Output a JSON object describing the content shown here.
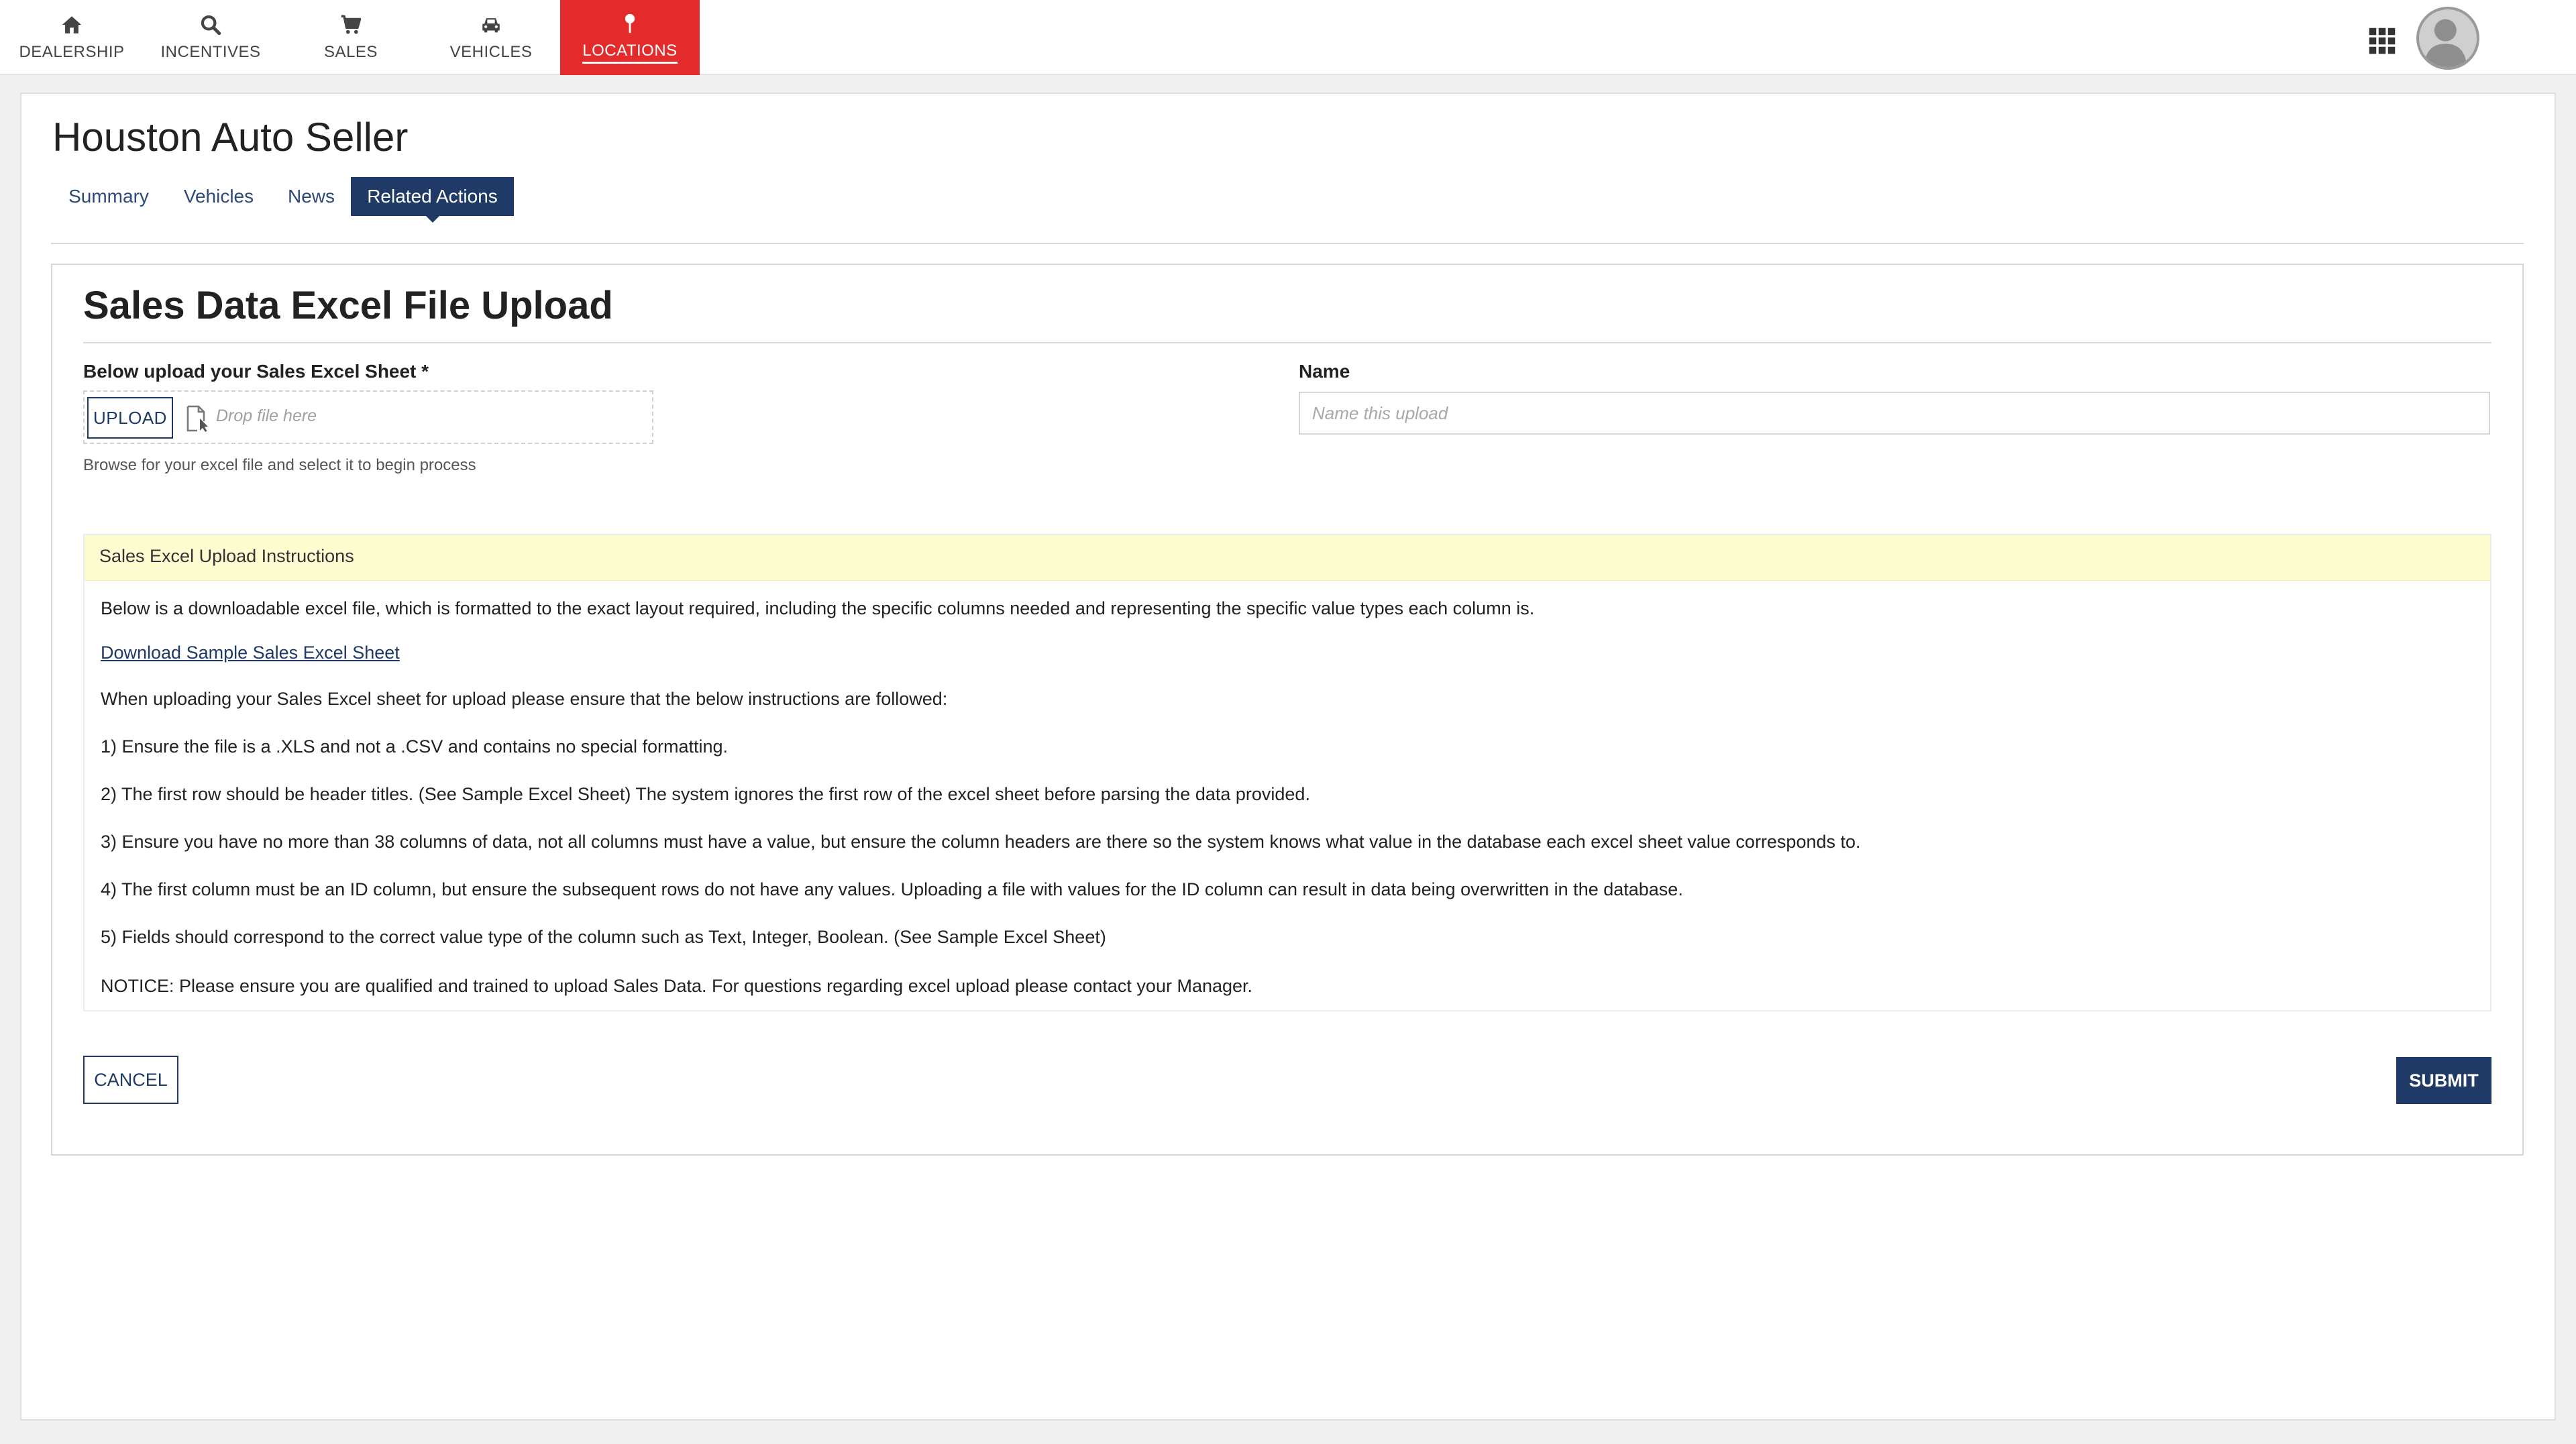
{
  "nav": {
    "items": [
      {
        "label": "DEALERSHIP",
        "icon": "home-icon"
      },
      {
        "label": "INCENTIVES",
        "icon": "search-icon"
      },
      {
        "label": "SALES",
        "icon": "cart-icon"
      },
      {
        "label": "VEHICLES",
        "icon": "car-icon"
      },
      {
        "label": "LOCATIONS",
        "icon": "pin-icon",
        "active": true
      }
    ],
    "accent_color": "#e32b2b",
    "apps_icon": "grid-icon",
    "avatar_icon": "user-avatar-icon"
  },
  "page": {
    "title": "Houston Auto Seller",
    "tabs": [
      {
        "label": "Summary"
      },
      {
        "label": "Vehicles"
      },
      {
        "label": "News"
      },
      {
        "label": "Related Actions",
        "active": true
      }
    ],
    "primary_color": "#1f3a66"
  },
  "form": {
    "title": "Sales Data Excel File Upload",
    "upload_label": "Below upload your Sales Excel Sheet *",
    "upload_button": "UPLOAD",
    "drop_placeholder": "Drop file here",
    "upload_help": "Browse for your excel file and select it to begin process",
    "name_label": "Name",
    "name_placeholder": "Name this upload",
    "name_value": ""
  },
  "instructions": {
    "heading": "Sales Excel Upload Instructions",
    "intro": "Below is a downloadable excel file, which is formatted to the exact layout required, including the specific columns needed and representing the specific value types each column is.",
    "download_link": "Download Sample Sales Excel Sheet",
    "lead": "When uploading your Sales Excel sheet for upload please ensure that the below instructions are followed:",
    "steps": [
      "1) Ensure the file is a .XLS and not a .CSV and contains no special formatting.",
      "2) The first row should be header titles. (See Sample Excel Sheet) The system ignores the first row of the excel sheet before parsing the data provided.",
      "3) Ensure you have no more than 38 columns of data, not all columns must have a value, but ensure the column headers are there so the system knows what value in the database each excel sheet value corresponds to.",
      "4) The first column must be an ID column, but ensure the subsequent rows do not have any values. Uploading a file with values for the ID column can result in data being overwritten in the database.",
      "5) Fields should correspond to the correct value type of the column such as Text, Integer, Boolean. (See Sample Excel Sheet)"
    ],
    "notice": "NOTICE: Please ensure you are qualified and trained to upload Sales Data. For questions regarding excel upload please contact your Manager.",
    "highlight_color": "#fdfbd0"
  },
  "actions": {
    "cancel": "CANCEL",
    "submit": "SUBMIT"
  }
}
